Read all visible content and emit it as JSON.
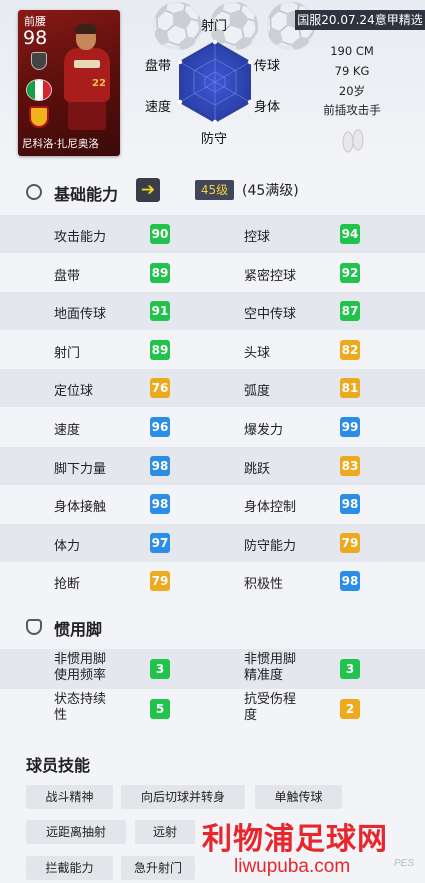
{
  "header": {
    "card": {
      "position": "前腰",
      "overall": "98",
      "player_name": "尼科洛·扎尼奥洛"
    },
    "radar": {
      "labels": {
        "top": "射门",
        "upper_left": "盘带",
        "upper_right": "传球",
        "lower_left": "速度",
        "lower_right": "身体",
        "bottom": "防守"
      }
    },
    "edition": "国服20.07.24意甲精选",
    "height": "190 CM",
    "weight": "79 KG",
    "age": "20岁",
    "role": "前插攻击手"
  },
  "basic": {
    "title": "基础能力",
    "level": "45级",
    "max_level": "(45满级)",
    "stats": [
      {
        "left_label": "攻击能力",
        "left_value": "90",
        "right_label": "控球",
        "right_value": "94"
      },
      {
        "left_label": "盘带",
        "left_value": "89",
        "right_label": "紧密控球",
        "right_value": "92"
      },
      {
        "left_label": "地面传球",
        "left_value": "91",
        "right_label": "空中传球",
        "right_value": "87"
      },
      {
        "left_label": "射门",
        "left_value": "89",
        "right_label": "头球",
        "right_value": "82"
      },
      {
        "left_label": "定位球",
        "left_value": "76",
        "right_label": "弧度",
        "right_value": "81"
      },
      {
        "left_label": "速度",
        "left_value": "96",
        "right_label": "爆发力",
        "right_value": "99"
      },
      {
        "left_label": "脚下力量",
        "left_value": "98",
        "right_label": "跳跃",
        "right_value": "83"
      },
      {
        "left_label": "身体接触",
        "left_value": "98",
        "right_label": "身体控制",
        "right_value": "98"
      },
      {
        "left_label": "体力",
        "left_value": "97",
        "right_label": "防守能力",
        "right_value": "79"
      },
      {
        "left_label": "抢断",
        "left_value": "79",
        "right_label": "积极性",
        "right_value": "98"
      }
    ]
  },
  "foot": {
    "title": "惯用脚",
    "rows": [
      {
        "left_line1": "非惯用脚",
        "left_line2": "使用频率",
        "left_value": "3",
        "right_line1": "非惯用脚",
        "right_line2": "精准度",
        "right_value": "3"
      },
      {
        "left_line1": "状态持续",
        "left_line2": "性",
        "left_value": "5",
        "right_line1": "抗受伤程",
        "right_line2": "度",
        "right_value": "2"
      }
    ]
  },
  "skills": {
    "title": "球员技能",
    "items": [
      "战斗精神",
      "向后切球并转身",
      "单触传球",
      "远距离抽射",
      "远射",
      "拦截能力",
      "急升射门"
    ]
  },
  "watermark": {
    "cn": "利物浦足球网",
    "en": "liwupuba.com",
    "mark": "PES"
  },
  "colors": {
    "green": "#22c34d",
    "blue": "#2b8de6",
    "orange": "#eeaa1e",
    "yellow": "#f3d21d"
  }
}
